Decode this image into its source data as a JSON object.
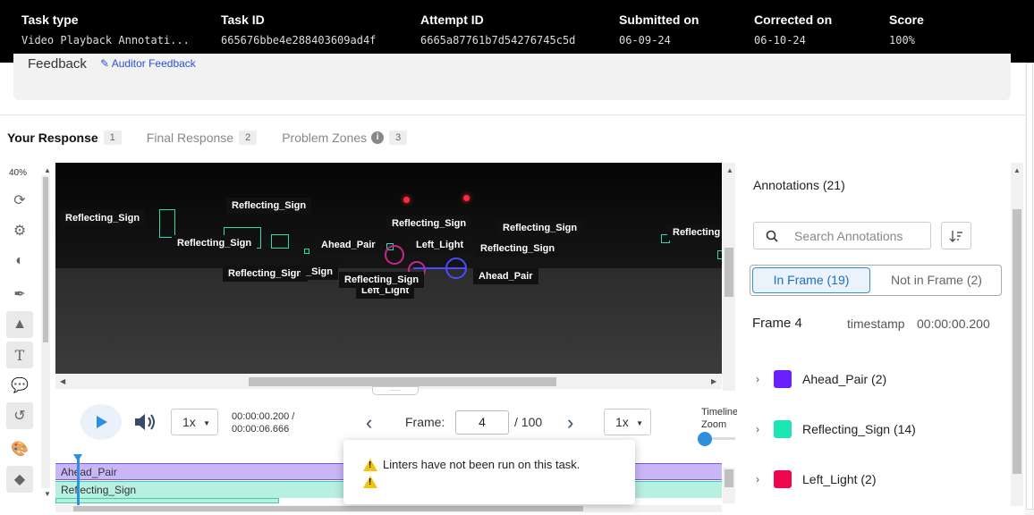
{
  "header": {
    "columns": [
      {
        "label": "Task type",
        "value": "Video Playback Annotati..."
      },
      {
        "label": "Task ID",
        "value": "665676bbe4e288403609ad4f"
      },
      {
        "label": "Attempt ID",
        "value": "6665a87761b7d54276745c5d"
      },
      {
        "label": "Submitted on",
        "value": "06-09-24"
      },
      {
        "label": "Corrected on",
        "value": "06-10-24"
      },
      {
        "label": "Score",
        "value": "100%"
      }
    ]
  },
  "feedback": {
    "title": "Feedback",
    "link": "Auditor Feedback"
  },
  "tabs": [
    {
      "label": "Your Response",
      "count": "1"
    },
    {
      "label": "Final Response",
      "count": "2"
    },
    {
      "label": "Problem Zones",
      "count": "3"
    }
  ],
  "toolbar": {
    "zoom": "40%",
    "icons": [
      "refresh-icon",
      "gear-icon",
      "contrast-icon",
      "pen-icon",
      "shapes-icon",
      "text-icon",
      "comments-icon",
      "history-icon",
      "palette-icon",
      "fill-icon"
    ]
  },
  "video_labels": {
    "reflecting_sign": "Reflecting_Sign",
    "reflecting_sign_partial": "Reflecting",
    "reflecting_sign_clipped": "_Sign",
    "ahead_pair": "Ahead_Pair",
    "left_light": "Left_Light"
  },
  "controls": {
    "speed": "1x",
    "time_current": "00:00:00.200 /",
    "time_total": "00:00:06.666",
    "frame_label": "Frame:",
    "frame_value": "4",
    "frame_total": "/ 100",
    "playback_rate": "1x",
    "timeline_zoom": "Timeline Zoom"
  },
  "timeline": {
    "rows": [
      "Ahead_Pair",
      "Reflecting_Sign"
    ]
  },
  "linter": {
    "message": "Linters have not been run on this task."
  },
  "annotations_panel": {
    "title": "Annotations (21)",
    "search_placeholder": "Search Annotations",
    "in_frame": "In Frame (19)",
    "not_in_frame": "Not in Frame (2)",
    "frame": "Frame 4",
    "timestamp_label": "timestamp",
    "timestamp_value": "00:00:00.200",
    "items": [
      {
        "label": "Ahead_Pair (2)",
        "color": "#6a1fff"
      },
      {
        "label": "Reflecting_Sign (14)",
        "color": "#1de5b5"
      },
      {
        "label": "Left_Light (2)",
        "color": "#f0064e"
      }
    ]
  },
  "colors": {
    "accent": "#2f8fde",
    "ahead_pair": "#6a1fff",
    "reflecting_sign": "#1de5b5",
    "left_light": "#f0064e"
  }
}
